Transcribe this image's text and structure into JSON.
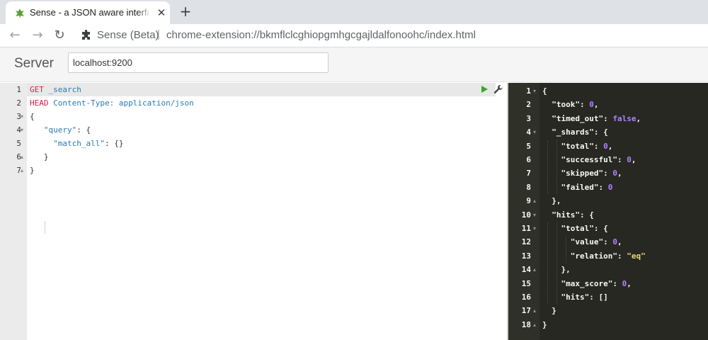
{
  "browser": {
    "tab_title": "Sense - a JSON aware interface",
    "tab_close_glyph": "✕",
    "new_tab_glyph": "+",
    "origin_label": "Sense (Beta)",
    "url_separator": "|",
    "url": "chrome-extension://bkmflclcghiopgmhgcgajldalfonoohc/index.html",
    "back_glyph": "←",
    "forward_glyph": "→",
    "reload_glyph": "↻"
  },
  "server": {
    "label": "Server",
    "value": "localhost:9200"
  },
  "request": {
    "lines": [
      {
        "num": "1",
        "fold": ""
      },
      {
        "num": "2",
        "fold": ""
      },
      {
        "num": "3",
        "fold": "▾"
      },
      {
        "num": "4",
        "fold": "▾"
      },
      {
        "num": "5",
        "fold": ""
      },
      {
        "num": "6",
        "fold": "▴"
      },
      {
        "num": "7",
        "fold": "▴"
      }
    ],
    "method": "GET",
    "path": "_search",
    "header_keyword": "HEAD",
    "header_value": "Content-Type: application/json",
    "open_brace": "{",
    "query_key": "\"query\"",
    "query_rest": ": {",
    "match_all_key": "\"match_all\"",
    "match_all_rest": ": {}",
    "inner_close": "}",
    "outer_close": "}"
  },
  "response": {
    "line_numbers": [
      "1",
      "2",
      "3",
      "4",
      "5",
      "6",
      "7",
      "8",
      "9",
      "10",
      "11",
      "12",
      "13",
      "14",
      "15",
      "16",
      "17",
      "18"
    ],
    "folds": [
      "▾",
      "",
      "",
      "▾",
      "",
      "",
      "",
      "",
      "▴",
      "▾",
      "▾",
      "",
      "",
      "▴",
      "",
      "",
      "▴",
      "▴"
    ],
    "lines": [
      {
        "indent": "",
        "parts": [
          {
            "t": "p",
            "v": "{"
          }
        ]
      },
      {
        "indent": "  ",
        "parts": [
          {
            "t": "p",
            "v": "\"took\": "
          },
          {
            "t": "n",
            "v": "0"
          },
          {
            "t": "p",
            "v": ","
          }
        ]
      },
      {
        "indent": "  ",
        "parts": [
          {
            "t": "p",
            "v": "\"timed_out\": "
          },
          {
            "t": "b",
            "v": "false"
          },
          {
            "t": "p",
            "v": ","
          }
        ]
      },
      {
        "indent": "  ",
        "parts": [
          {
            "t": "p",
            "v": "\"_shards\": {"
          }
        ]
      },
      {
        "indent": "    ",
        "parts": [
          {
            "t": "p",
            "v": "\"total\": "
          },
          {
            "t": "n",
            "v": "0"
          },
          {
            "t": "p",
            "v": ","
          }
        ]
      },
      {
        "indent": "    ",
        "parts": [
          {
            "t": "p",
            "v": "\"successful\": "
          },
          {
            "t": "n",
            "v": "0"
          },
          {
            "t": "p",
            "v": ","
          }
        ]
      },
      {
        "indent": "    ",
        "parts": [
          {
            "t": "p",
            "v": "\"skipped\": "
          },
          {
            "t": "n",
            "v": "0"
          },
          {
            "t": "p",
            "v": ","
          }
        ]
      },
      {
        "indent": "    ",
        "parts": [
          {
            "t": "p",
            "v": "\"failed\": "
          },
          {
            "t": "n",
            "v": "0"
          }
        ]
      },
      {
        "indent": "  ",
        "parts": [
          {
            "t": "p",
            "v": "},"
          }
        ]
      },
      {
        "indent": "  ",
        "parts": [
          {
            "t": "p",
            "v": "\"hits\": {"
          }
        ]
      },
      {
        "indent": "    ",
        "parts": [
          {
            "t": "p",
            "v": "\"total\": {"
          }
        ]
      },
      {
        "indent": "      ",
        "parts": [
          {
            "t": "p",
            "v": "\"value\": "
          },
          {
            "t": "n",
            "v": "0"
          },
          {
            "t": "p",
            "v": ","
          }
        ]
      },
      {
        "indent": "      ",
        "parts": [
          {
            "t": "p",
            "v": "\"relation\": "
          },
          {
            "t": "s",
            "v": "\"eq\""
          }
        ]
      },
      {
        "indent": "    ",
        "parts": [
          {
            "t": "p",
            "v": "},"
          }
        ]
      },
      {
        "indent": "    ",
        "parts": [
          {
            "t": "p",
            "v": "\"max_score\": "
          },
          {
            "t": "n",
            "v": "0"
          },
          {
            "t": "p",
            "v": ","
          }
        ]
      },
      {
        "indent": "    ",
        "parts": [
          {
            "t": "p",
            "v": "\"hits\": []"
          }
        ]
      },
      {
        "indent": "  ",
        "parts": [
          {
            "t": "p",
            "v": "}"
          }
        ]
      },
      {
        "indent": "",
        "parts": [
          {
            "t": "p",
            "v": "}"
          }
        ]
      }
    ]
  },
  "colors": {
    "run_icon": "#36a82a",
    "response_bg": "#272822",
    "request_method": "#c7254e",
    "request_keyword": "#2a7ab0"
  },
  "icons": {
    "tab_favicon": "sense-leaf-icon",
    "extension": "puzzle-icon",
    "run": "play-icon",
    "settings": "wrench-icon"
  }
}
